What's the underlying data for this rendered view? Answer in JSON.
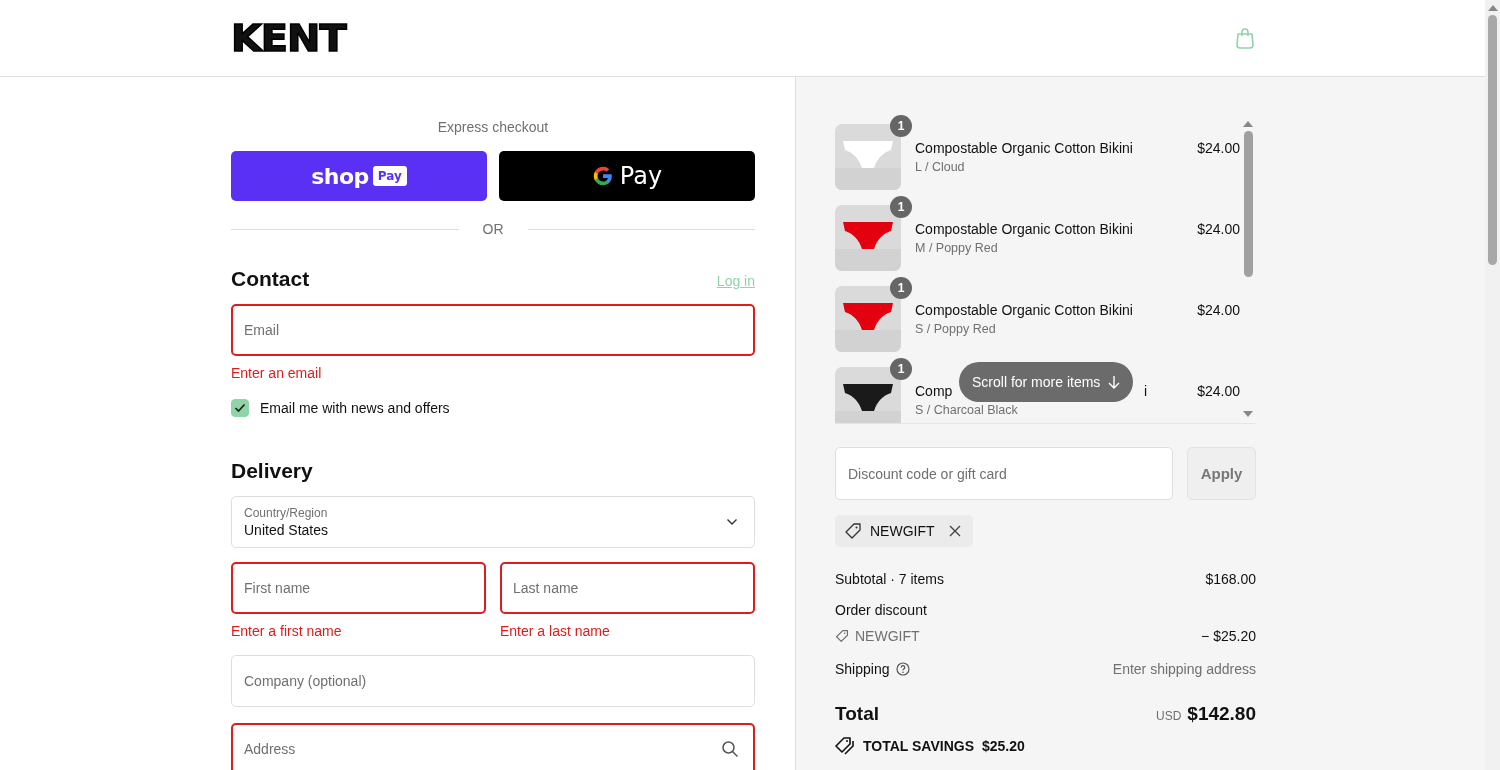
{
  "header": {
    "logo": "KENT"
  },
  "express": {
    "title": "Express checkout",
    "buttons": [
      {
        "kind": "shoppay",
        "label": "shop",
        "badge": "Pay"
      },
      {
        "kind": "gpay",
        "label": "Pay"
      }
    ],
    "divider": "OR"
  },
  "contact": {
    "heading": "Contact",
    "login": "Log in",
    "email": {
      "placeholder": "Email",
      "invalid": true,
      "error": "Enter an email"
    },
    "newsletter": {
      "label": "Email me with news and offers",
      "checked": true
    }
  },
  "delivery": {
    "heading": "Delivery",
    "country": {
      "label": "Country/Region",
      "value": "United States"
    },
    "name_fields": [
      {
        "placeholder": "First name",
        "invalid": true,
        "error": "Enter a first name"
      },
      {
        "placeholder": "Last name",
        "invalid": true,
        "error": "Enter a last name"
      }
    ],
    "fields": [
      {
        "kind": "text",
        "placeholder": "Company (optional)",
        "invalid": false
      },
      {
        "kind": "search",
        "placeholder": "Address",
        "invalid": true
      }
    ]
  },
  "cart": {
    "items": [
      {
        "quantity": "1",
        "title": "Compostable Organic Cotton Bikini",
        "variant": "L / Cloud",
        "price": "$24.00",
        "color": "#ffffff"
      },
      {
        "quantity": "1",
        "title": "Compostable Organic Cotton Bikini",
        "variant": "M / Poppy Red",
        "price": "$24.00",
        "color": "#e3000f"
      },
      {
        "quantity": "1",
        "title": "Compostable Organic Cotton Bikini",
        "variant": "S / Poppy Red",
        "price": "$24.00",
        "color": "#e3000f"
      },
      {
        "quantity": "1",
        "title": "Comp",
        "title_tail": "i",
        "variant": "S / Charcoal Black",
        "price": "$24.00",
        "color": "#1a1a1a"
      }
    ],
    "scroll_hint": "Scroll for more items"
  },
  "discount": {
    "placeholder": "Discount code or gift card",
    "button": "Apply",
    "applied_code": "NEWGIFT"
  },
  "summary": {
    "subtotal_label": "Subtotal · 7 items",
    "subtotal": "$168.00",
    "discount_label": "Order discount",
    "discount_code": "NEWGIFT",
    "discount_amount": "− $25.20",
    "shipping_label": "Shipping",
    "shipping_value": "Enter shipping address",
    "total_label": "Total",
    "currency": "USD",
    "total": "$142.80",
    "savings_label": "TOTAL SAVINGS",
    "savings": "$25.20"
  }
}
